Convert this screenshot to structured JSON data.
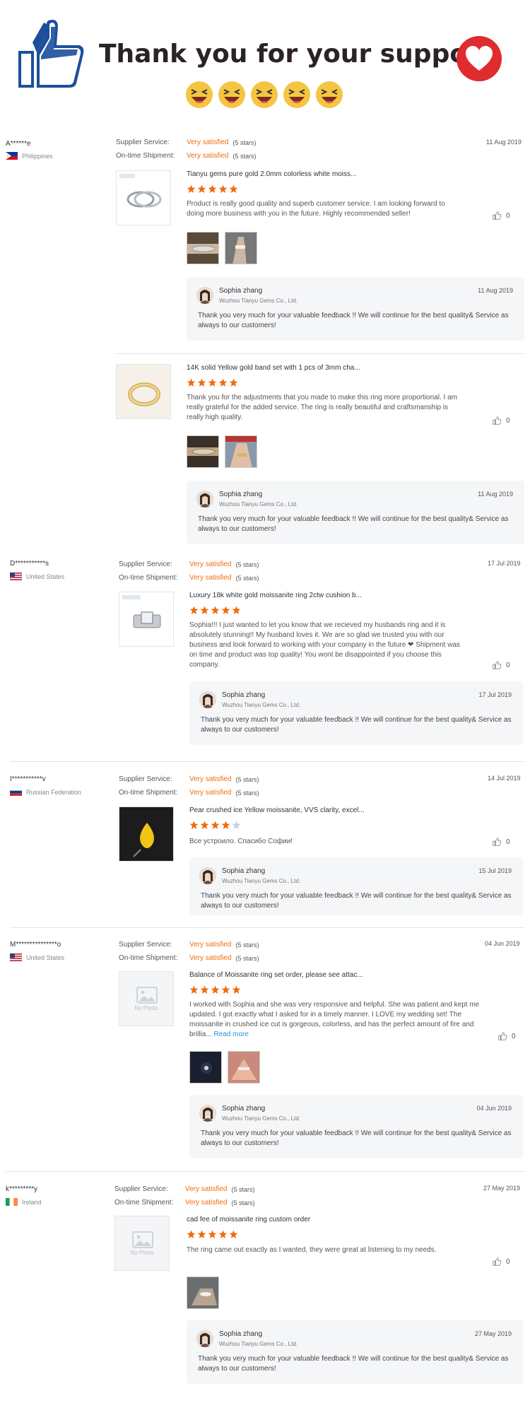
{
  "banner": {
    "title": "Thank you for your support.",
    "thumbs_icon": "thumbs-up-icon",
    "heart_icon": "heart-icon",
    "emoji_icon": "laughing-emoji-icon",
    "emoji_count": 5,
    "colors": {
      "thumb": "#1b4f9c",
      "heart": "#e02b2f",
      "emoji": "#f5c542"
    }
  },
  "labels": {
    "supplier_service": "Supplier Service:",
    "on_time_shipment": "On-time Shipment:",
    "very_satisfied": "Very satisfied",
    "five_stars": "(5 stars)",
    "no_photo": "No Photo",
    "read_more": "Read more"
  },
  "seller_reply": {
    "name": "Sophia zhang",
    "company": "Wuzhou Tianyu Gems Co., Ltd.",
    "text": "Thank you very much for your valuable feedback !!  We will continue for the best quality& Service as always to our customers!"
  },
  "reviews": [
    {
      "buyer": "A******e",
      "country": "Philippines",
      "date": "11 Aug 2019",
      "product": "Tianyu gems pure gold 2.0mm colorless white moiss...",
      "stars": 5,
      "text": "Product is really good quality and superb customer service. I am looking forward to doing more business with you in the future. Highly recommended seller!",
      "helpful": "0",
      "reply_date": "11 Aug 2019"
    },
    {
      "buyer": "",
      "country": "",
      "date": "",
      "product": "14K solid Yellow gold band set with 1 pcs of 3mm cha...",
      "stars": 5,
      "text": "Thank you for the adjustments that you made to make this ring more proportional. I am really grateful for the added service. The ring is really beautiful and craftsmanship is really high quality.",
      "helpful": "0",
      "reply_date": "11 Aug 2019"
    },
    {
      "buyer": "D***********s",
      "country": "United States",
      "date": "17 Jul 2019",
      "product": "Luxury 18k white gold moissanite ring 2ctw cushion b...",
      "stars": 5,
      "text": "Sophia!!! I just wanted to let you know that we recieved my husbands ring and it is absolutely stunning!! My husband loves it. We are so glad we trusted you with our business and look forward to working with your company in the future ❤ Shipment was on time and product was top quality! You wont be disappointed if you choose this company.",
      "helpful": "0",
      "reply_date": "17 Jul 2019"
    },
    {
      "buyer": "I***********v",
      "country": "Russian Federation",
      "date": "14 Jul 2019",
      "product": "Pear crushed ice Yellow moissanite, VVS clarity, excel...",
      "stars": 4,
      "text": "Все устроило. Спасибо Софии!",
      "helpful": "0",
      "reply_date": "15 Jul 2019"
    },
    {
      "buyer": "M***************o",
      "country": "United States",
      "date": "04 Jun 2019",
      "product": "Balance of Moissanite ring set order, please see attac...",
      "stars": 5,
      "text": "I worked with Sophia and she was very responsive and helpful. She was patient and kept me updated.  I got exactly what I asked for in a timely manner.  I LOVE my wedding set! The moissanite in crushed ice cut is gorgeous, colorless, and has the perfect amount of fire and brillia...",
      "helpful": "0",
      "reply_date": "04 Jun 2019"
    },
    {
      "buyer": "k*********y",
      "country": "Ireland",
      "date": "27 May 2019",
      "product": "cad fee of moissanite ring custom order",
      "stars": 5,
      "text": "The ring came out exactly as I wanted, they were great at listening to my needs.",
      "helpful": "0",
      "reply_date": "27 May 2019"
    }
  ]
}
